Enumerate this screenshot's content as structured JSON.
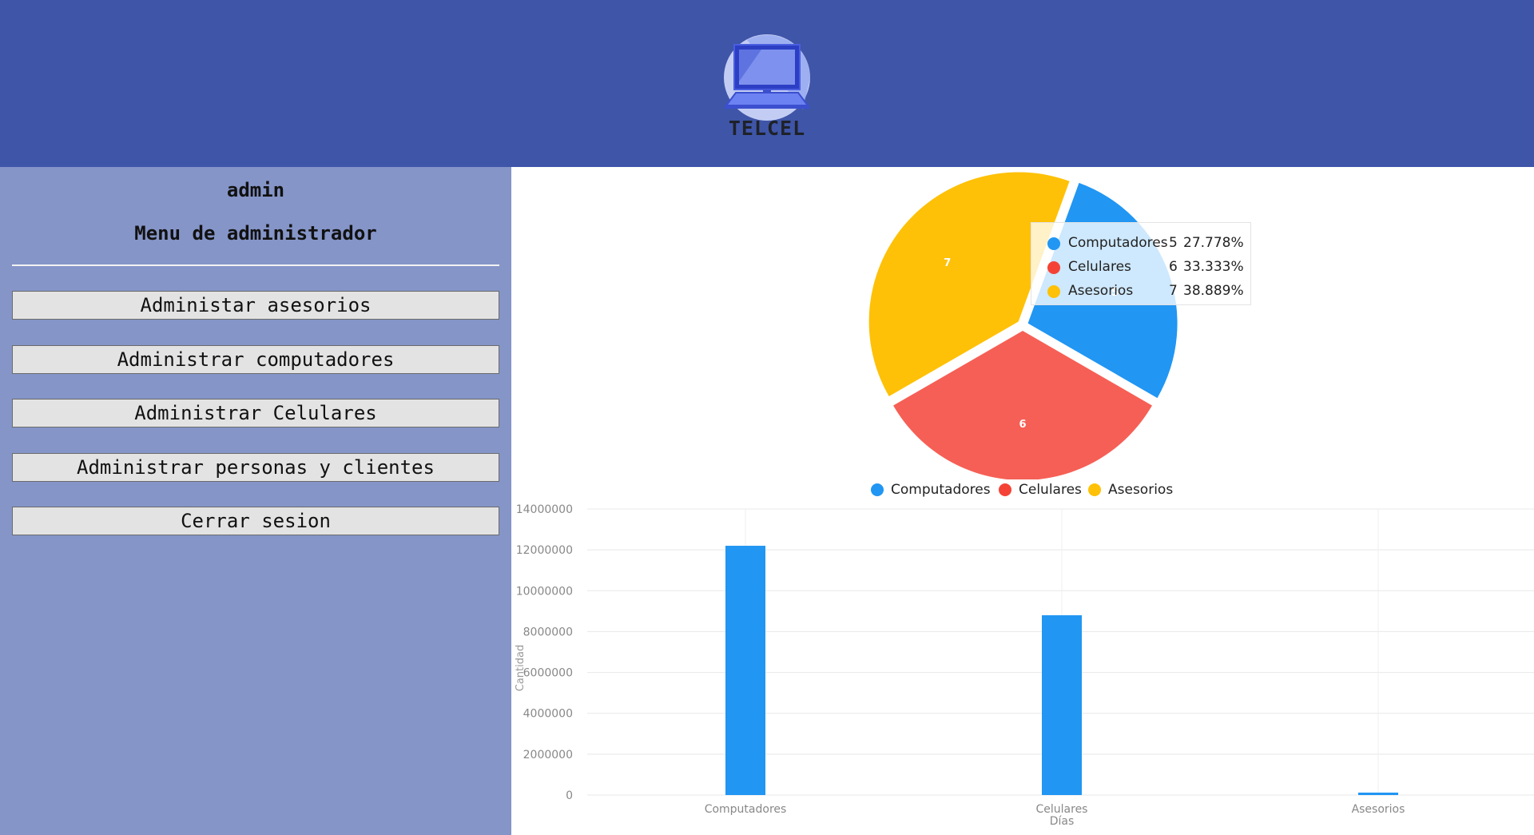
{
  "header": {
    "brand": "TELCEL",
    "logo_icon": "laptop-icon",
    "background": "#3f55a8"
  },
  "sidebar": {
    "user": "admin",
    "title": "Menu de administrador",
    "buttons": [
      "Administar asesorios",
      "Administrar computadores",
      "Administrar Celulares",
      "Administrar personas y clientes",
      "Cerrar sesion"
    ],
    "background": "#8595c8"
  },
  "tooltip": {
    "rows": [
      {
        "label": "Computadores",
        "value": "5",
        "percent": "27.778%"
      },
      {
        "label": "Celulares",
        "value": "6",
        "percent": "33.333%"
      },
      {
        "label": "Asesorios",
        "value": "7",
        "percent": "38.889%"
      }
    ]
  },
  "chart_data": [
    {
      "type": "pie",
      "categories": [
        "Computadores",
        "Celulares",
        "Asesorios"
      ],
      "values": [
        5,
        6,
        7
      ],
      "colors": [
        "#2196f3",
        "#f65f55",
        "#fec107"
      ],
      "legend": "bottom",
      "data_labels": true
    },
    {
      "type": "bar",
      "categories": [
        "Computadores",
        "Celulares",
        "Asesorios"
      ],
      "values": [
        12200000,
        8800000,
        120000
      ],
      "color": "#2196f3",
      "xlabel": "Días",
      "ylabel": "Cantidad",
      "ylim": [
        0,
        14000000
      ],
      "yticks": [
        "0",
        "2000000",
        "4000000",
        "6000000",
        "8000000",
        "10000000",
        "12000000",
        "14000000"
      ],
      "grid": true
    }
  ]
}
